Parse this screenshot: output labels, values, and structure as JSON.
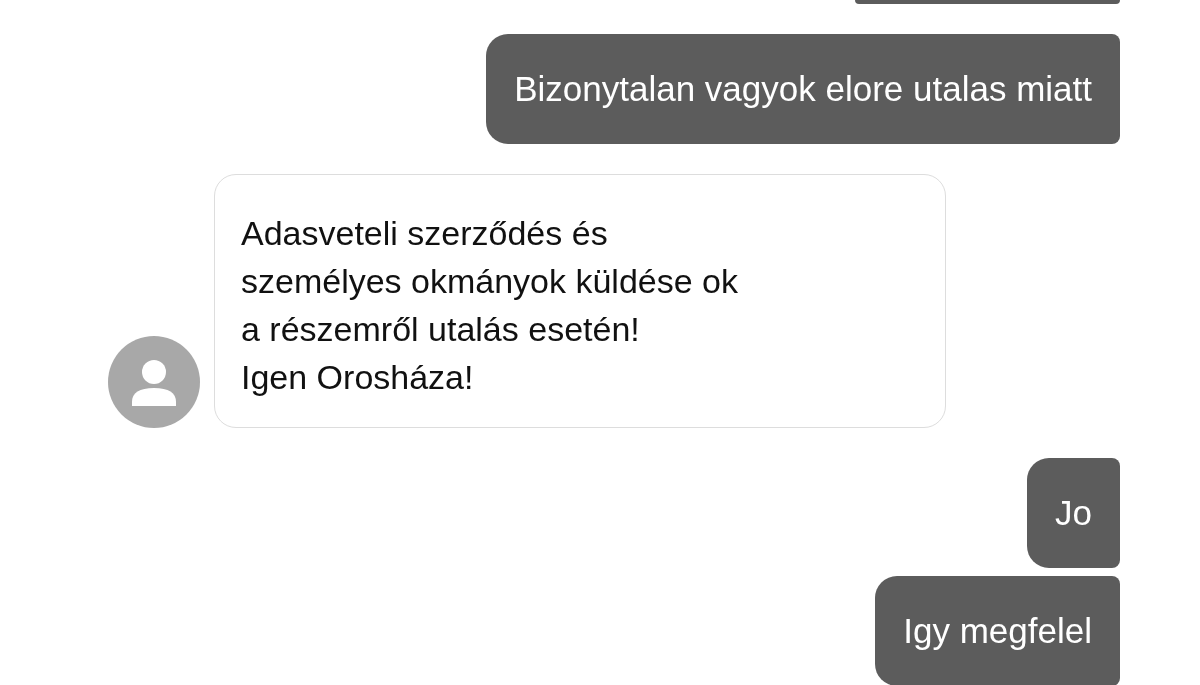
{
  "messages": [
    {
      "kind": "partial"
    },
    {
      "kind": "sent",
      "text": "Bizonytalan vagyok elore utalas miatt"
    },
    {
      "kind": "received",
      "lines": [
        "Adasveteli szerződés és",
        "személyes okmányok küldése ok",
        "a részemről utalás esetén!",
        "Igen Orosháza!"
      ]
    },
    {
      "kind": "sent",
      "text": "Jo"
    },
    {
      "kind": "sent",
      "text": "Igy megfelel"
    }
  ]
}
